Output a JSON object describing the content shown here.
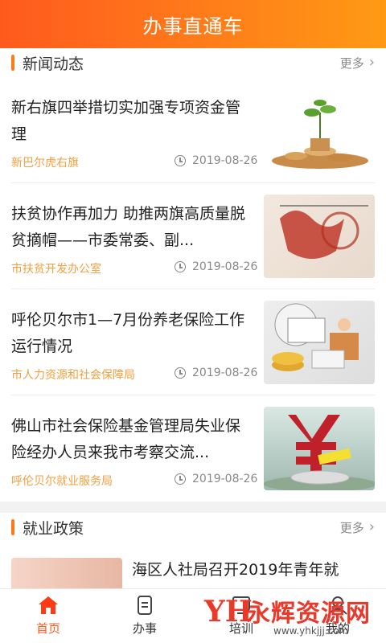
{
  "header": {
    "title": "办事直通车"
  },
  "news": {
    "section_title": "新闻动态",
    "more_label": "更多",
    "items": [
      {
        "title": "新右旗四举措切实加强专项资金管理",
        "source": "新巴尔虎右旗",
        "date": "2019-08-26",
        "thumb": "plant-coins-image"
      },
      {
        "title": "扶贫协作再加力 助推两旗高质量脱贫摘帽——市委常委、副...",
        "source": "市扶贫开发办公室",
        "date": "2019-08-26",
        "thumb": "poverty-relief-image"
      },
      {
        "title": "呼伦贝尔市1—7月份养老保险工作运行情况",
        "source": "市人力资源和社会保障局",
        "date": "2019-08-26",
        "thumb": "pension-image"
      },
      {
        "title": "佛山市社会保险基金管理局失业保险经办人员来我市考察交流...",
        "source": "呼伦贝尔就业服务局",
        "date": "2019-08-26",
        "thumb": "insurance-yuan-image"
      }
    ]
  },
  "policy": {
    "section_title": "就业政策",
    "more_label": "更多",
    "items": [
      {
        "title": "海区人社局召开2019年青年就"
      }
    ]
  },
  "tabs": [
    {
      "label": "首页",
      "icon": "home-icon",
      "active": true
    },
    {
      "label": "办事",
      "icon": "document-icon",
      "active": false
    },
    {
      "label": "培训",
      "icon": "training-icon",
      "active": false
    },
    {
      "label": "我的",
      "icon": "profile-icon",
      "active": false
    }
  ],
  "watermark": {
    "text": "永辉资源网",
    "url": "www.yhkjjj.com"
  },
  "colors": {
    "accent": "#ff5a1e",
    "source_text": "#f0a040"
  }
}
